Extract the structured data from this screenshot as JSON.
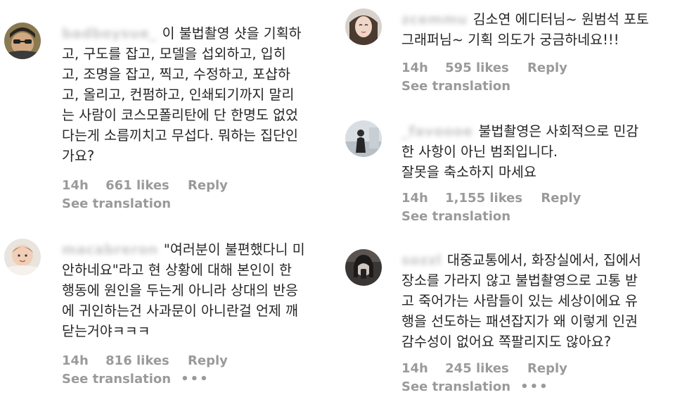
{
  "comments_left": [
    {
      "username": "badboysue_",
      "lines": [
        "이 불법촬영 샷을 기획하",
        "고, 구도를 잡고, 모델을 섭외하고, 입히",
        "고, 조명을 잡고, 찍고, 수정하고, 포샵하",
        "고, 올리고, 컨펌하고, 인쇄되기까지 말리",
        "는 사람이 코스모폴리탄에 단 한명도 없었",
        "다는게 소름끼치고 무섭다. 뭐하는 집단인",
        "가요?"
      ],
      "time": "14h",
      "likes": "661 likes",
      "reply": "Reply",
      "see_translation": "See translation",
      "more": ""
    },
    {
      "username": "macabreron",
      "lines": [
        "\"여러분이 불편했다니 미",
        "안하네요\"라고 현 상황에 대해 본인이 한",
        "행동에 원인을 두는게 아니라 상대의 반응",
        "에 귀인하는건 사과문이 아니란걸 언제 깨",
        "닫는거야ㅋㅋㅋ"
      ],
      "time": "14h",
      "likes": "816 likes",
      "reply": "Reply",
      "see_translation": "See translation",
      "more": "•••"
    }
  ],
  "comments_right": [
    {
      "username": "zcemmu",
      "lines": [
        "김소연 에디터님~ 원범석 포토",
        "그래퍼님~ 기획 의도가 궁금하네요!!!"
      ],
      "time": "14h",
      "likes": "595 likes",
      "reply": "Reply",
      "see_translation": "See translation",
      "more": ""
    },
    {
      "username": "_favoooe",
      "lines": [
        "불법촬영은 사회적으로 민감",
        "한 사항이 아닌 범죄입니다.",
        "잘못을 축소하지 마세요"
      ],
      "time": "14h",
      "likes": "1,155 likes",
      "reply": "Reply",
      "see_translation": "See translation",
      "more": ""
    },
    {
      "username": "sozzl",
      "lines": [
        "대중교통에서, 화장실에서, 집에서",
        "장소를 가라지 않고 불법촬영으로 고통 받",
        "고 죽어가는 사람들이 있는 세상이에요 유",
        "행을 선도하는 패션잡지가 왜 이렇게 인권",
        "감수성이 없어요 쪽팔리지도 않아요?"
      ],
      "time": "14h",
      "likes": "245 likes",
      "reply": "Reply",
      "see_translation": "See translation",
      "more": "•••"
    }
  ],
  "colors": {
    "text": "#262626",
    "meta": "#9a9a9a",
    "background": "#ffffff"
  }
}
